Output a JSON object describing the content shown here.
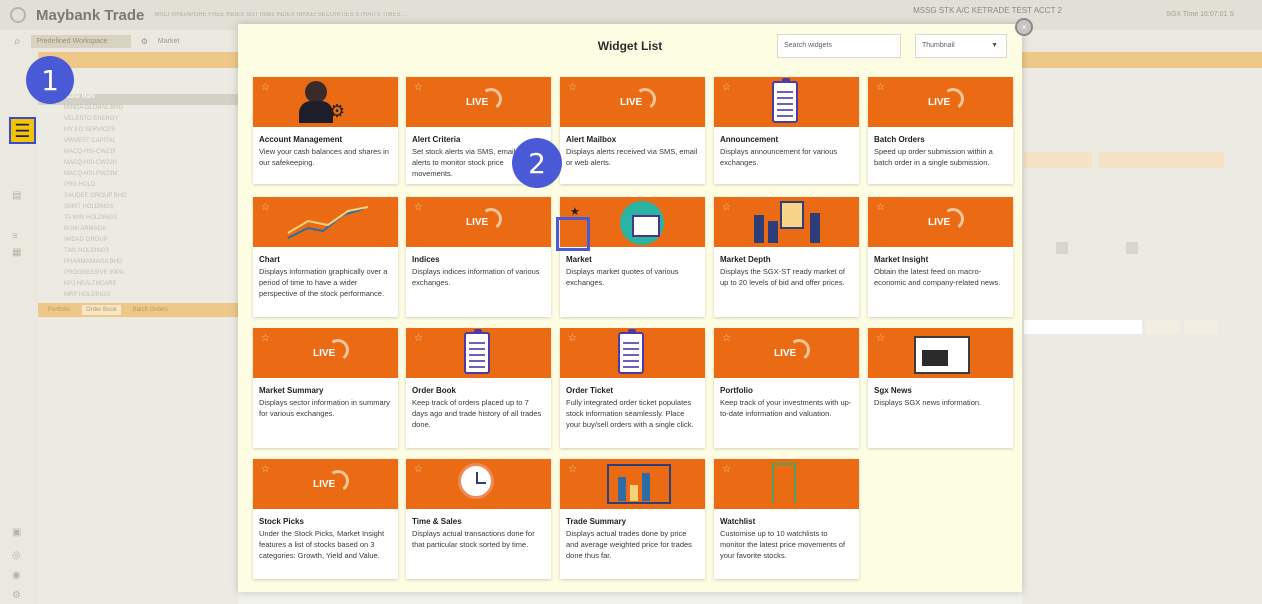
{
  "app": {
    "brand": "Maybank Trade",
    "account": "MSSG STK A/C KETRADE TEST ACCT 2",
    "time_label": "SGX Time 16:07:01 S",
    "workspace": "Predefined Workspace",
    "market_tab": "Market",
    "ticker": "MSCI SINGAPORE FREE INDEX SGT Index INDEX NIKKEI SECURITIES STRAITS TIMES ..."
  },
  "left_panel": {
    "rows": [
      "Name  Mark",
      "MINDA GLOBAL BHD",
      "VELESTO ENERGY",
      "MY EG SERVICES",
      "VINVEST CAPITAL",
      "MACQ-HSI-CW21F",
      "MACQ-HSI-CW22H",
      "MACQ-HSI-PW23M",
      "PRG HOLD",
      "SAUDEE GROUP BHD",
      "SMRT HOLDINGS",
      "TA WIN HOLDINGS",
      "BUMI ARMADA",
      "WIDAD GROUP",
      "TWL HOLDINGS",
      "PHARMANIAGA BHD",
      "PROGRESSIVE IMPA",
      "KPJ HEALTHCARE",
      "MRP HOLDINGS"
    ],
    "tabs": [
      "Portfolio",
      "Order Book",
      "Batch Orders"
    ]
  },
  "modal": {
    "title": "Widget List",
    "search_placeholder": "Search widgets",
    "view_mode": "Thumbnail",
    "close_label": "×"
  },
  "annotations": {
    "one": "1",
    "two": "2"
  },
  "widgets": [
    {
      "title": "Account Management",
      "desc": "View your cash balances and shares in our safekeeping.",
      "icon": "account-manager-icon"
    },
    {
      "title": "Alert Criteria",
      "desc": "Set stock alerts via SMS, email or web alerts to monitor stock price movements.",
      "icon": "live-icon"
    },
    {
      "title": "Alert Mailbox",
      "desc": "Displays alerts received via SMS, email or web alerts.",
      "icon": "live-icon"
    },
    {
      "title": "Announcement",
      "desc": "Displays announcement for various exchanges.",
      "icon": "clipboard-icon"
    },
    {
      "title": "Batch Orders",
      "desc": "Speed up order submission within a batch order in a single submission.",
      "icon": "live-icon"
    },
    {
      "title": "Chart",
      "desc": "Displays information graphically over a period of time to have a wider perspective of the stock performance.",
      "icon": "line-chart-icon"
    },
    {
      "title": "Indices",
      "desc": "Displays indices information of various exchanges.",
      "icon": "live-icon"
    },
    {
      "title": "Market",
      "desc": "Displays market quotes of various exchanges.",
      "icon": "globe-screen-icon"
    },
    {
      "title": "Market Depth",
      "desc": "Displays the SGX-ST ready market of up to 20 levels of bid and offer prices.",
      "icon": "people-board-icon"
    },
    {
      "title": "Market Insight",
      "desc": "Obtain the latest feed on macro-economic and company-related news.",
      "icon": "live-icon"
    },
    {
      "title": "Market Summary",
      "desc": "Displays sector information in summary for various exchanges.",
      "icon": "live-icon"
    },
    {
      "title": "Order Book",
      "desc": "Keep track of orders placed up to 7 days ago and trade history of all trades done.",
      "icon": "clipboard-icon"
    },
    {
      "title": "Order Ticket",
      "desc": "Fully integrated order ticket populates stock information seamlessly. Place your buy/sell orders with a single click.",
      "icon": "clipboard-icon"
    },
    {
      "title": "Portfolio",
      "desc": "Keep track of your investments with up-to-date information and valuation.",
      "icon": "live-icon"
    },
    {
      "title": "Sgx News",
      "desc": "Displays SGX news information.",
      "icon": "newspaper-icon"
    },
    {
      "title": "Stock Picks",
      "desc": "Under the Stock Picks, Market Insight features a list of stocks based on 3 categories: Growth, Yield and Value.",
      "icon": "live-icon"
    },
    {
      "title": "Time & Sales",
      "desc": "Displays actual transactions done for that particular stock sorted by time.",
      "icon": "clock-icon"
    },
    {
      "title": "Trade Summary",
      "desc": "Displays actual trades done by price and average weighted price for trades done thus far.",
      "icon": "bar-chart-icon"
    },
    {
      "title": "Watchlist",
      "desc": "Customise up to 10 watchlists to monitor the latest price movements of your favorite stocks.",
      "icon": "bookmark-icon"
    }
  ],
  "live_label": "LIVE",
  "colors": {
    "card_banner": "#eb6b14",
    "annotation": "#4a5ad6",
    "highlight_yellow": "#f3c400"
  }
}
